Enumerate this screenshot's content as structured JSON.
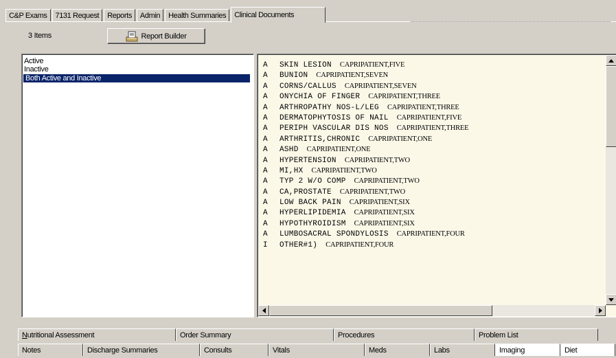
{
  "top_tabs": [
    {
      "label": "C&P Exams"
    },
    {
      "label": "7131 Request"
    },
    {
      "label": "Reports"
    },
    {
      "label": "Admin"
    },
    {
      "label": "Health Summaries"
    },
    {
      "label": "Clinical Documents"
    }
  ],
  "items_count": "3 Items",
  "report_builder_label": "Report Builder",
  "filter_list": [
    "Active",
    "Inactive",
    "Both Active and Inactive"
  ],
  "selected_filter": "Both Active and Inactive",
  "problems": [
    {
      "status": "A",
      "problem": "SKIN LESION",
      "patient": "CAPRIPATIENT,FIVE"
    },
    {
      "status": "A",
      "problem": "BUNION",
      "patient": "CAPRIPATIENT,SEVEN"
    },
    {
      "status": "A",
      "problem": "CORNS/CALLUS",
      "patient": "CAPRIPATIENT,SEVEN"
    },
    {
      "status": "A",
      "problem": "ONYCHIA OF FINGER",
      "patient": "CAPRIPATIENT,THREE"
    },
    {
      "status": "A",
      "problem": "ARTHROPATHY NOS-L/LEG",
      "patient": "CAPRIPATIENT,THREE"
    },
    {
      "status": "A",
      "problem": "DERMATOPHYTOSIS OF NAIL",
      "patient": "CAPRIPATIENT,FIVE"
    },
    {
      "status": "A",
      "problem": "PERIPH VASCULAR DIS NOS",
      "patient": "CAPRIPATIENT,THREE"
    },
    {
      "status": "A",
      "problem": "ARTHRITIS,CHRONIC",
      "patient": "CAPRIPATIENT,ONE"
    },
    {
      "status": "A",
      "problem": "ASHD",
      "patient": "CAPRIPATIENT,ONE"
    },
    {
      "status": "A",
      "problem": "HYPERTENSION",
      "patient": "CAPRIPATIENT,TWO"
    },
    {
      "status": "A",
      "problem": "MI,HX",
      "patient": "CAPRIPATIENT,TWO"
    },
    {
      "status": "A",
      "problem": "TYP 2 W/O COMP",
      "patient": "CAPRIPATIENT,TWO"
    },
    {
      "status": "A",
      "problem": "CA,PROSTATE",
      "patient": "CAPRIPATIENT,TWO"
    },
    {
      "status": "A",
      "problem": "LOW BACK PAIN",
      "patient": "CAPRIPATIENT,SIX"
    },
    {
      "status": "A",
      "problem": "HYPERLIPIDEMIA",
      "patient": "CAPRIPATIENT,SIX"
    },
    {
      "status": "A",
      "problem": "HYPOTHYROIDISM",
      "patient": "CAPRIPATIENT,SIX"
    },
    {
      "status": "A",
      "problem": "LUMBOSACRAL SPONDYLOSIS",
      "patient": "CAPRIPATIENT,FOUR"
    },
    {
      "status": "I",
      "problem": "OTHER#1)",
      "patient": "CAPRIPATIENT,FOUR"
    }
  ],
  "bottom_tabs_row1": [
    "Nutritional Assessment",
    "Order Summary",
    "Procedures",
    "Problem List"
  ],
  "bottom_tabs_row2": [
    "Notes",
    "Discharge Summaries",
    "Consults",
    "Vitals",
    "Meds",
    "Labs",
    "Imaging",
    "Diet"
  ]
}
